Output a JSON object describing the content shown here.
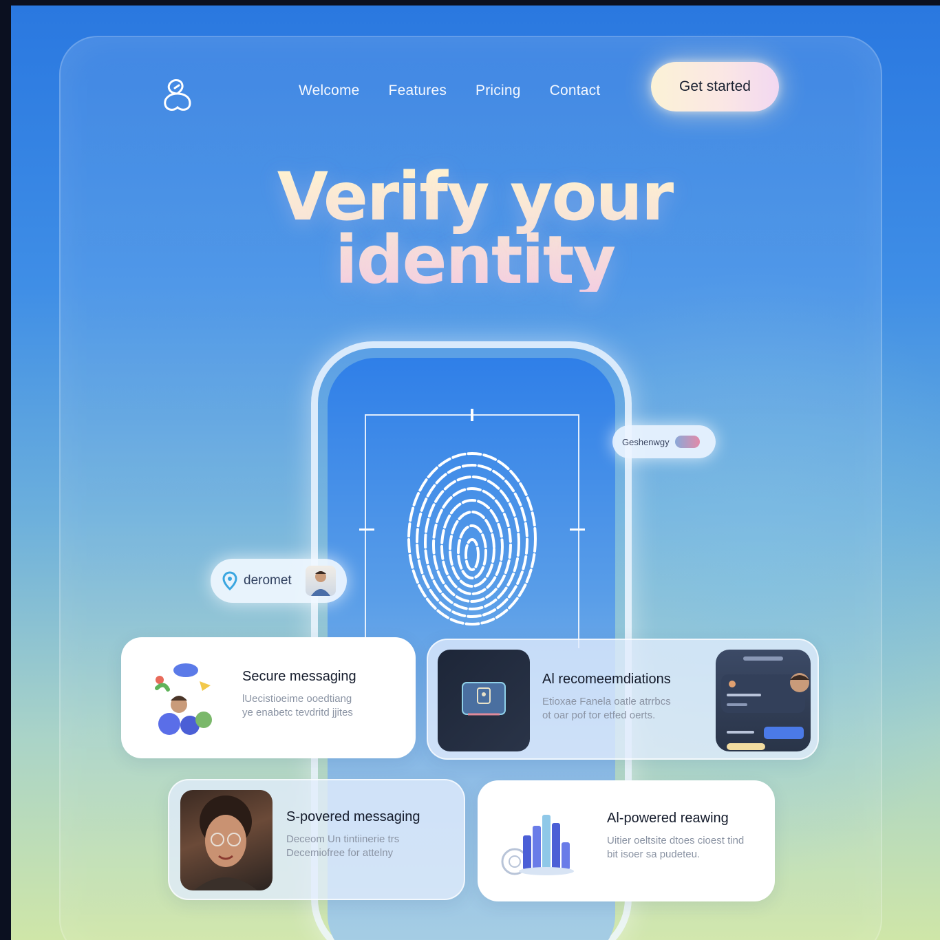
{
  "nav": {
    "links": [
      "Welcome",
      "Features",
      "Pricing",
      "Contact"
    ],
    "cta_label": "Get started"
  },
  "hero": {
    "line1": "Verify your",
    "line2": "identity"
  },
  "chips": {
    "right_text": "Geshenwgy",
    "left_text": "deromet"
  },
  "cards": [
    {
      "title": "Secure messaging",
      "desc_line1": "lUecistioeime ooedtiang",
      "desc_line2": "ye enabetc tevdritd jjites"
    },
    {
      "title": "Al recomeemdiations",
      "desc_line1": "Etioxae Fanela oatle atrrbcs",
      "desc_line2": "ot oar pof tor etfed oerts."
    },
    {
      "title": "S-povered messaging",
      "desc_line1": "Deceom Un tintiinerie trs",
      "desc_line2": "Decemiofree for attelny"
    },
    {
      "title": "Al-powered reawing",
      "desc_line1": "Uitier oeltsite dtoes cioest tind",
      "desc_line2": "bit isoer sa pudeteu."
    }
  ],
  "colors": {
    "bg_top": "#2a78e0",
    "bg_bottom": "#cfe6a8",
    "cta_gradient_start": "#fbf2d6",
    "cta_gradient_end": "#f2d8f1",
    "card_title": "#141b2b",
    "card_desc": "#8a93a3"
  },
  "icons": [
    "logo-icon",
    "fingerprint-icon",
    "location-pin-icon"
  ]
}
